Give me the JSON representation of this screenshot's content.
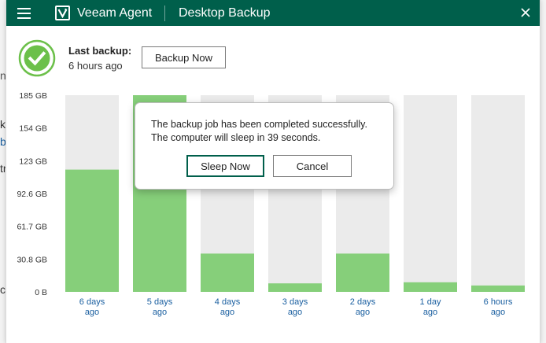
{
  "background_fragments": [
    "nc",
    "k",
    "b",
    "tr",
    "ch"
  ],
  "titlebar": {
    "app_name": "Veeam Agent",
    "window_title": "Desktop Backup"
  },
  "status": {
    "label": "Last backup:",
    "time": "6 hours ago",
    "backup_button": "Backup Now"
  },
  "chart_data": {
    "type": "bar",
    "y_ticks": [
      "185 GB",
      "154 GB",
      "123 GB",
      "92.6 GB",
      "61.7 GB",
      "30.8 GB",
      "0 B"
    ],
    "ylim": [
      0,
      185
    ],
    "categories": [
      [
        "6 days",
        "ago"
      ],
      [
        "5 days",
        "ago"
      ],
      [
        "4 days",
        "ago"
      ],
      [
        "3 days",
        "ago"
      ],
      [
        "2 days",
        "ago"
      ],
      [
        "1 day",
        "ago"
      ],
      [
        "6 hours",
        "ago"
      ]
    ],
    "values": [
      115,
      185,
      36,
      8,
      36,
      9,
      6
    ],
    "colors": {
      "bar": "#86cf7a",
      "track": "#ebebeb",
      "label": "#1a5fa0"
    }
  },
  "dialog": {
    "line1": "The backup job has been completed successfully.",
    "line2": "The computer will sleep in 39 seconds.",
    "sleep_button": "Sleep Now",
    "cancel_button": "Cancel"
  },
  "colors": {
    "titlebar": "#005f4b",
    "success": "#6cc04a"
  }
}
